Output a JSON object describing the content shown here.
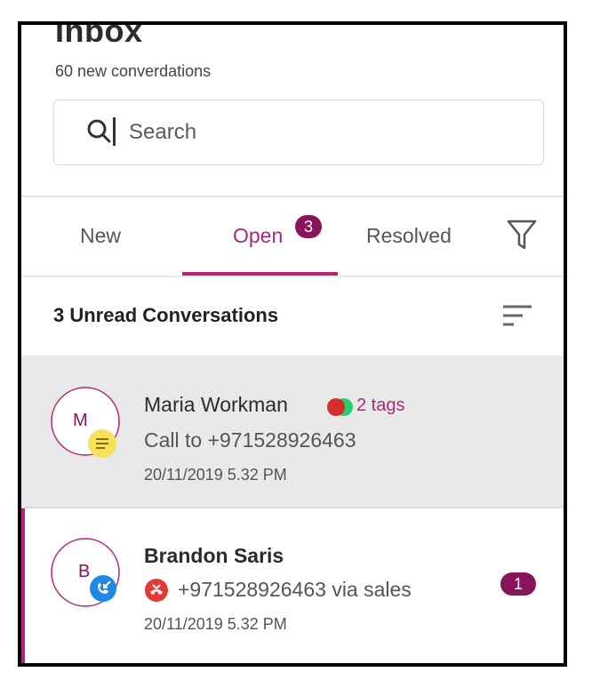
{
  "header": {
    "title": "Inbox",
    "subtitle": "60 new converdations"
  },
  "search": {
    "placeholder": "Search",
    "value": ""
  },
  "tabs": [
    {
      "label": "New",
      "active": false
    },
    {
      "label": "Open",
      "active": true,
      "badge": "3"
    },
    {
      "label": "Resolved",
      "active": false
    }
  ],
  "section": {
    "title": "3 Unread Conversations"
  },
  "conversations": [
    {
      "initial": "M",
      "name": "Maria Workman",
      "tags_label": "2 tags",
      "detail": "Call to +971528926463",
      "timestamp": "20/11/2019  5.32 PM",
      "status_icon": "note-icon",
      "highlighted": true
    },
    {
      "initial": "B",
      "name": "Brandon Saris",
      "detail": "+971528926463 via sales",
      "timestamp": "20/11/2019  5.32 PM",
      "status_icon": "incoming-call-icon",
      "call_icon": "missed-call-icon",
      "unread_count": "1"
    }
  ],
  "colors": {
    "accent": "#b0277a",
    "badge": "#8a145c",
    "selected_row": "#e9e9e9",
    "note_badge": "#f7e05a",
    "call_badge": "#1e88e5",
    "missed_call": "#e53935",
    "tag_red": "#d32f2f",
    "tag_green": "#2ecc71"
  }
}
